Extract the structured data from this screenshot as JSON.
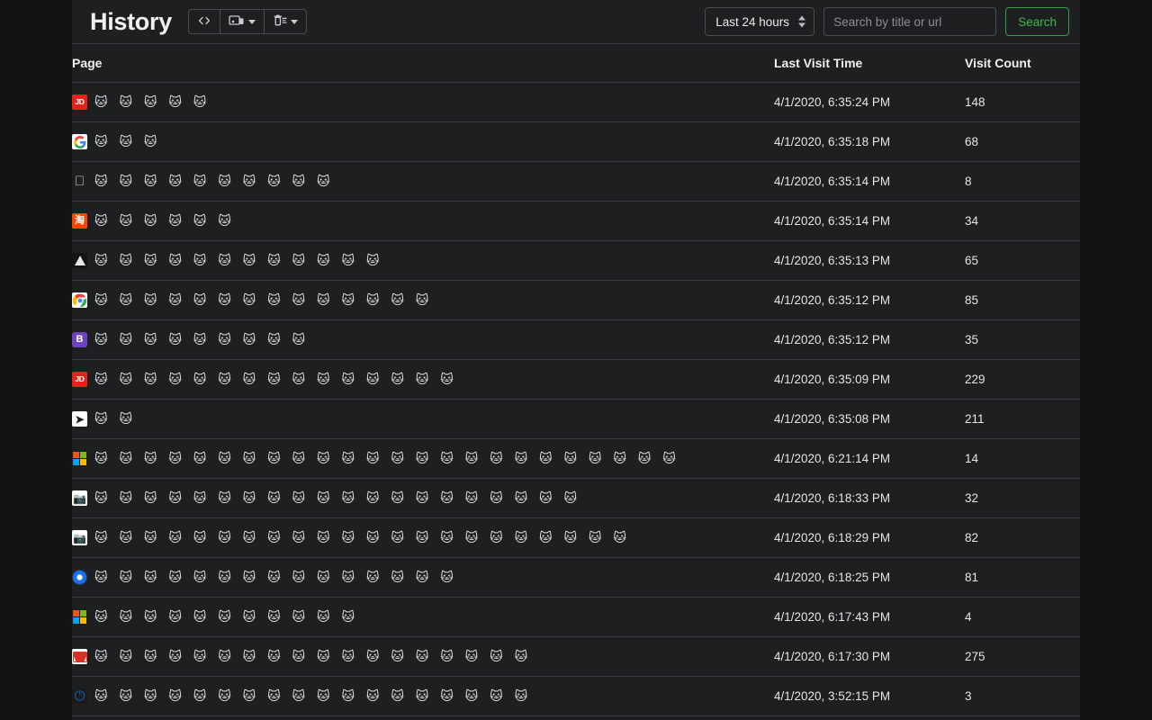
{
  "app": {
    "title": "History",
    "background": "#131313",
    "panel_background": "#1d1f20",
    "accent_green": "#3fb950"
  },
  "toolbar": {
    "code_button": {
      "label": "< >",
      "icon": "code-brackets-icon"
    },
    "devices_button": {
      "icon": "devices-icon",
      "caret": "chevron-down-icon"
    },
    "delete_button": {
      "icon": "trash-list-icon",
      "caret": "chevron-down-icon"
    }
  },
  "search": {
    "range_value": "Last 24 hours",
    "placeholder": "Search by title or url",
    "input_value": "",
    "button_label": "Search"
  },
  "table": {
    "columns": [
      "Page",
      "Last Visit Time",
      "Visit Count"
    ],
    "rows": [
      {
        "favicon": "jd",
        "title": "🐱 🐱 🐱 🐱 🐱",
        "time": "4/1/2020, 6:35:24 PM",
        "count": "148"
      },
      {
        "favicon": "google",
        "title": "🐱 🐱 🐱",
        "time": "4/1/2020, 6:35:18 PM",
        "count": "68"
      },
      {
        "favicon": "apple",
        "title": "🐱 🐱 🐱 🐱 🐱 🐱 🐱 🐱 🐱 🐱",
        "time": "4/1/2020, 6:35:14 PM",
        "count": "8"
      },
      {
        "favicon": "taobao",
        "title": "🐱 🐱 🐱 🐱 🐱 🐱",
        "time": "4/1/2020, 6:35:14 PM",
        "count": "34"
      },
      {
        "favicon": "triangle",
        "title": "🐱 🐱 🐱 🐱 🐱 🐱 🐱 🐱 🐱 🐱 🐱 🐱",
        "time": "4/1/2020, 6:35:13 PM",
        "count": "65"
      },
      {
        "favicon": "chrome",
        "title": "🐱 🐱 🐱 🐱 🐱 🐱 🐱 🐱 🐱 🐱 🐱 🐱 🐱 🐱",
        "time": "4/1/2020, 6:35:12 PM",
        "count": "85"
      },
      {
        "favicon": "bilibili",
        "title": "🐱 🐱 🐱 🐱 🐱 🐱 🐱 🐱 🐱",
        "time": "4/1/2020, 6:35:12 PM",
        "count": "35"
      },
      {
        "favicon": "jd",
        "title": "🐱 🐱 🐱 🐱 🐱 🐱 🐱 🐱 🐱 🐱 🐱 🐱 🐱 🐱 🐱",
        "time": "4/1/2020, 6:35:09 PM",
        "count": "229"
      },
      {
        "favicon": "arrow",
        "title": "🐱 🐱",
        "time": "4/1/2020, 6:35:08 PM",
        "count": "211"
      },
      {
        "favicon": "microsoft",
        "title": "🐱 🐱 🐱 🐱 🐱 🐱 🐱 🐱 🐱 🐱 🐱 🐱 🐱 🐱 🐱 🐱 🐱 🐱 🐱 🐱 🐱 🐱 🐱 🐱",
        "time": "4/1/2020, 6:21:14 PM",
        "count": "14"
      },
      {
        "favicon": "camera",
        "title": "🐱 🐱 🐱 🐱 🐱 🐱 🐱 🐱 🐱 🐱 🐱 🐱 🐱 🐱 🐱 🐱 🐱 🐱 🐱 🐱",
        "time": "4/1/2020, 6:18:33 PM",
        "count": "32"
      },
      {
        "favicon": "camera",
        "title": "🐱 🐱 🐱 🐱 🐱 🐱 🐱 🐱 🐱 🐱 🐱 🐱 🐱 🐱 🐱 🐱 🐱 🐱 🐱 🐱 🐱 🐱",
        "time": "4/1/2020, 6:18:29 PM",
        "count": "82"
      },
      {
        "favicon": "bluedot",
        "title": "🐱 🐱 🐱 🐱 🐱 🐱 🐱 🐱 🐱 🐱 🐱 🐱 🐱 🐱 🐱",
        "time": "4/1/2020, 6:18:25 PM",
        "count": "81"
      },
      {
        "favicon": "microsoft",
        "title": "🐱 🐱 🐱 🐱 🐱 🐱 🐱 🐱 🐱 🐱 🐱",
        "time": "4/1/2020, 6:17:43 PM",
        "count": "4"
      },
      {
        "favicon": "gmail",
        "title": "🐱 🐱 🐱 🐱 🐱 🐱 🐱 🐱 🐱 🐱 🐱 🐱 🐱 🐱 🐱 🐱 🐱 🐱",
        "time": "4/1/2020, 6:17:30 PM",
        "count": "275"
      },
      {
        "favicon": "history",
        "title": "🐱 🐱 🐱 🐱 🐱 🐱 🐱 🐱 🐱 🐱 🐱 🐱 🐱 🐱 🐱 🐱 🐱 🐱",
        "time": "4/1/2020, 3:52:15 PM",
        "count": "3"
      }
    ]
  }
}
